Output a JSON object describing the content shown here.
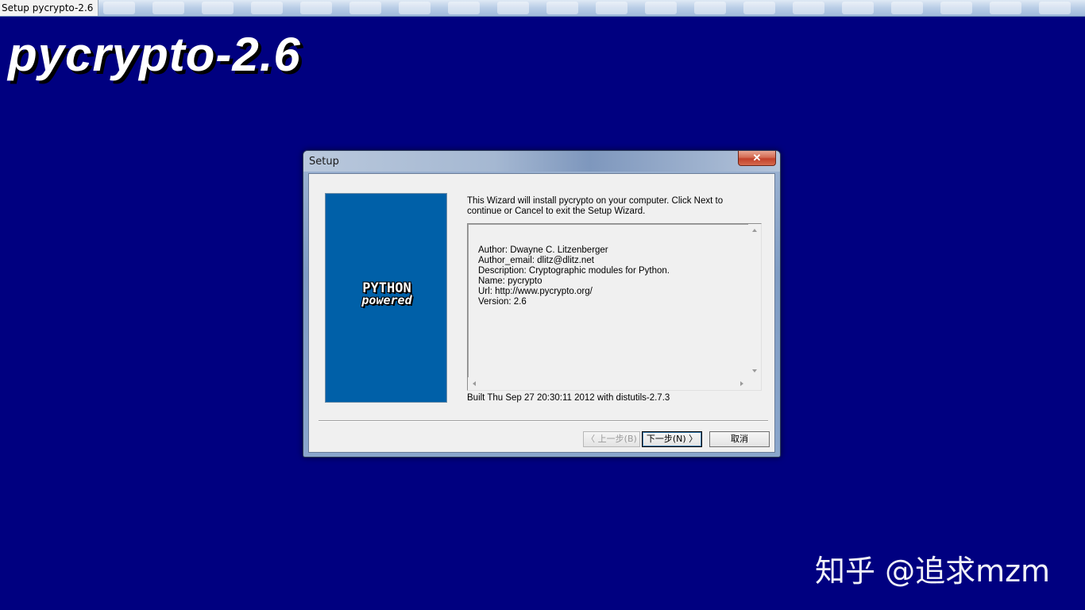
{
  "taskbar": {
    "title": "Setup pycrypto-2.6"
  },
  "installer": {
    "big_title": "pycrypto-2.6"
  },
  "dialog": {
    "title": "Setup",
    "close_symbol": "✕",
    "banner": {
      "logo_line1": "PYTHON",
      "logo_line2": "powered"
    },
    "intro_text": "This Wizard will install pycrypto on your computer. Click Next to continue or Cancel to exit the Setup Wizard.",
    "info_lines": [
      "Author: Dwayne C. Litzenberger",
      "Author_email: dlitz@dlitz.net",
      "Description: Cryptographic modules for Python.",
      "Name: pycrypto",
      "Url: http://www.pycrypto.org/",
      "Version: 2.6"
    ],
    "built_text": "Built Thu Sep 27 20:30:11 2012 with distutils-2.7.3",
    "buttons": {
      "back": "〈 上一步(B)",
      "next": "下一步(N) 〉",
      "cancel": "取消"
    }
  },
  "watermark": "知乎 @追求mzm",
  "colors": {
    "desktop_background": "#000080",
    "banner_background": "#0060a8"
  }
}
